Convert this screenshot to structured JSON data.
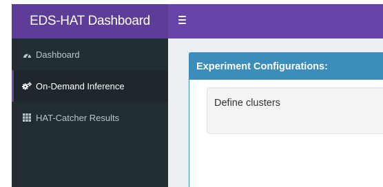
{
  "header": {
    "logo_text": "EDS-HAT Dashboard",
    "toggle_icon": "hamburger-menu-icon"
  },
  "sidebar": {
    "items": [
      {
        "label": "Dashboard",
        "icon": "dashboard-gauge-icon",
        "active": false
      },
      {
        "label": "On-Demand Inference",
        "icon": "cogs-icon",
        "active": true
      },
      {
        "label": "HAT-Catcher Results",
        "icon": "grid-icon",
        "active": false
      }
    ]
  },
  "main": {
    "box_title": "Experiment Configurations:",
    "well_label": "Define clusters"
  },
  "colors": {
    "logo_bg": "#5d3d97",
    "navbar_bg": "#6843a8",
    "sidebar_bg": "#222d32",
    "sidebar_active_bg": "#1e282c",
    "box_header_bg": "#3c8dbc",
    "content_bg": "#ecf0f5"
  }
}
